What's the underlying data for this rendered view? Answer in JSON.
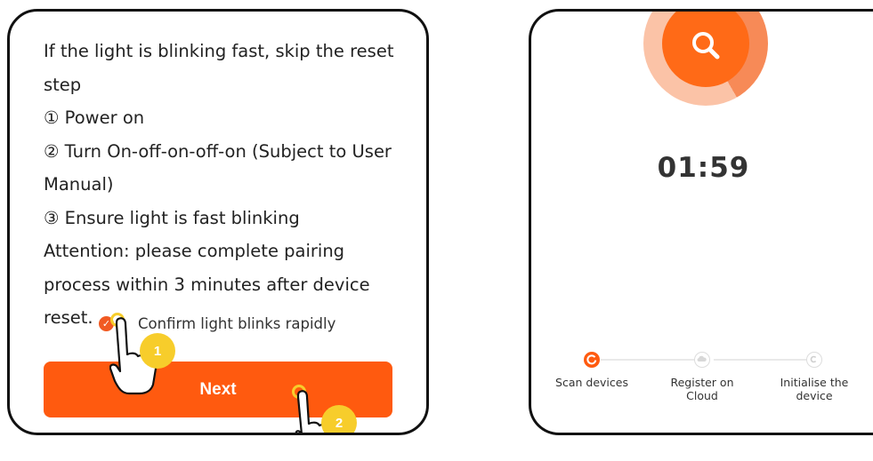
{
  "left_screen": {
    "instructions": [
      "If the light is blinking fast, skip the reset step",
      "① Power on",
      "② Turn On-off-on-off-on (Subject to User Manual)",
      "③ Ensure light is fast blinking",
      "Attention: please complete pairing process within 3 minutes after device reset."
    ],
    "confirm_checkbox": {
      "checked": true,
      "label": "Confirm light blinks rapidly"
    },
    "next_button_label": "Next",
    "tap_markers": [
      "1",
      "2"
    ]
  },
  "right_screen": {
    "timer": "01:59",
    "steps": [
      {
        "label": "Scan devices",
        "state": "active"
      },
      {
        "label": "Register on Cloud",
        "state": "pending"
      },
      {
        "label": "Initialise the device",
        "state": "pending"
      }
    ],
    "icons": {
      "search": "search-icon",
      "step1": "refresh-icon",
      "step2": "cloud-icon",
      "step3": "copyright-icon"
    }
  },
  "colors": {
    "accent": "#ff5a0f",
    "marker": "#f7cd2b"
  }
}
